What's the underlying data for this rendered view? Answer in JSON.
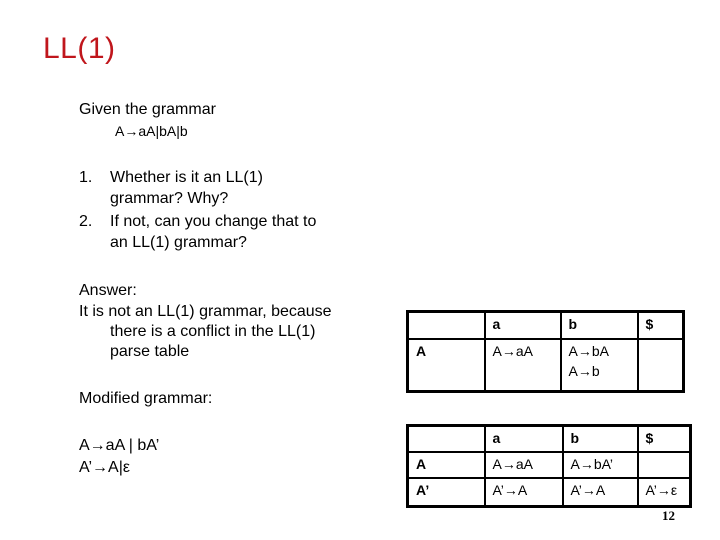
{
  "slide": {
    "title": "LL(1)",
    "given_label": "Given the grammar",
    "given_grammar": "A→aA|bA|b",
    "questions": [
      {
        "num": "1.",
        "line1": "Whether is it an LL(1)",
        "line2": "grammar? Why?"
      },
      {
        "num": "2.",
        "line1": "If not, can you change that to",
        "line2": "an LL(1) grammar?"
      }
    ],
    "answer_label": "Answer:",
    "answer_line1": "It is not an LL(1) grammar, because",
    "answer_line2": "there is a conflict in the LL(1)",
    "answer_line3": "parse table",
    "modified_label": "Modified grammar:",
    "modified_rules": [
      "A→aA | bA’",
      "A’→A|ε"
    ],
    "page_number": "12"
  },
  "table1": {
    "headers": [
      "",
      "a",
      "b",
      "$"
    ],
    "rows": [
      {
        "nonterminal": "A",
        "cells": [
          "A→aA",
          "A→bA",
          "A→b",
          ""
        ]
      }
    ]
  },
  "table2": {
    "headers": [
      "",
      "a",
      "b",
      "$"
    ],
    "rows": [
      {
        "nonterminal": "A",
        "cells": [
          "A→aA",
          "A→bA’",
          ""
        ]
      },
      {
        "nonterminal": "A’",
        "cells": [
          "A’→A",
          "A’→A",
          "A’→ε"
        ]
      }
    ]
  }
}
